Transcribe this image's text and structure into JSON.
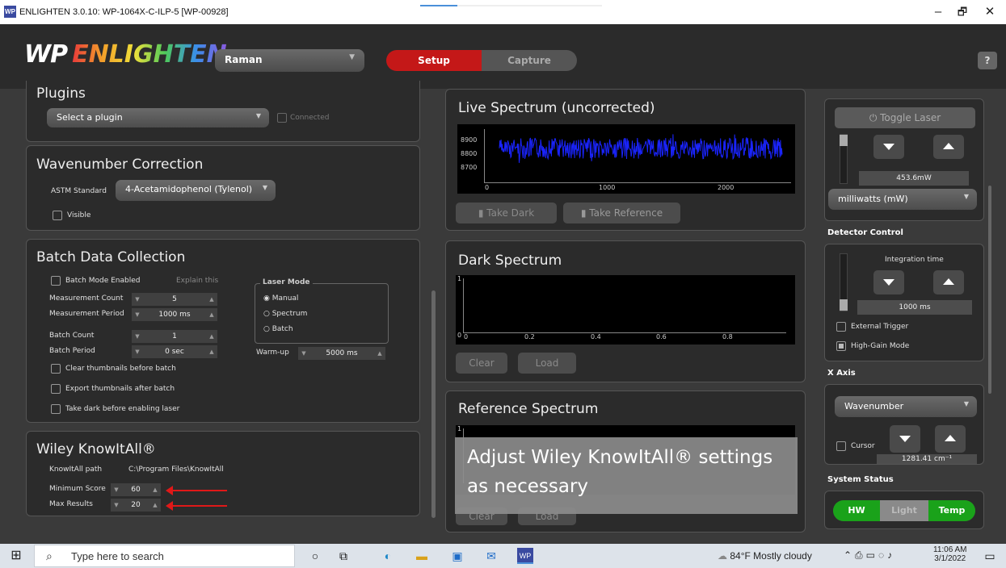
{
  "window": {
    "title": "ENLIGHTEN 3.0.10: WP-1064X-C-ILP-5 [WP-00928]",
    "icon": "wp-app-icon",
    "min": "–",
    "max": "🗗",
    "close": "✕"
  },
  "header": {
    "logo_wp": "WP",
    "logo_name": "ENLIGHTEN",
    "mode": "Raman",
    "tabs": {
      "setup": "Setup",
      "capture": "Capture"
    },
    "help": "?"
  },
  "plugins": {
    "title": "Plugins",
    "select": "Select a plugin",
    "connected": "Connected"
  },
  "wavenumber": {
    "title": "Wavenumber Correction",
    "astm_label": "ASTM Standard",
    "astm_value": "4-Acetamidophenol (Tylenol)",
    "visible": "Visible"
  },
  "batch": {
    "title": "Batch Data Collection",
    "enabled": "Batch Mode Enabled",
    "explain": "Explain this",
    "rows": [
      {
        "label": "Measurement Count",
        "value": "5"
      },
      {
        "label": "Measurement Period",
        "value": "1000 ms"
      },
      {
        "label": "Batch Count",
        "value": "1"
      },
      {
        "label": "Batch Period",
        "value": "0 sec"
      }
    ],
    "laser_mode": {
      "title": "Laser Mode",
      "options": [
        "Manual",
        "Spectrum",
        "Batch"
      ],
      "selected": "Manual"
    },
    "warmup_label": "Warm-up",
    "warmup_value": "5000 ms",
    "checks": [
      "Clear thumbnails before batch",
      "Export thumbnails after batch",
      "Take dark before enabling laser"
    ]
  },
  "knowitall": {
    "title": "Wiley KnowItAll®",
    "path_label": "KnowItAll path",
    "path_value": "C:\\Program Files\\KnowItAll",
    "min_label": "Minimum Score",
    "min_value": "60",
    "max_label": "Max Results",
    "max_value": "20"
  },
  "live": {
    "title": "Live Spectrum (uncorrected)",
    "yticks": [
      "8900",
      "8800",
      "8700"
    ],
    "xticks": [
      "0",
      "1000",
      "2000"
    ],
    "take_dark": "Take Dark",
    "take_reference": "Take Reference"
  },
  "dark": {
    "title": "Dark Spectrum",
    "ytop": "1",
    "ybottom": "0",
    "xticks": [
      "0",
      "0.2",
      "0.4",
      "0.6",
      "0.8"
    ],
    "clear": "Clear",
    "load": "Load"
  },
  "reference": {
    "title": "Reference Spectrum",
    "ytop": "1",
    "clear": "Clear",
    "load": "Load"
  },
  "caption": "Adjust Wiley KnowItAll® settings as necessary",
  "laser": {
    "toggle": "Toggle Laser",
    "power": "453.6mW",
    "unit": "milliwatts (mW)"
  },
  "detector": {
    "title": "Detector Control",
    "integration_label": "Integration time",
    "integration_value": "1000 ms",
    "external_trigger": "External Trigger",
    "high_gain": "High-Gain Mode"
  },
  "xaxis": {
    "title": "X Axis",
    "unit": "Wavenumber",
    "cursor": "Cursor",
    "cursor_value": "1281.41 cm⁻¹"
  },
  "system": {
    "title": "System Status",
    "hw": "HW",
    "light": "Light",
    "temp": "Temp",
    "colors": {
      "hw": "#1aa21a",
      "light": "#8a8a8a",
      "temp": "#1aa21a"
    }
  },
  "taskbar": {
    "search": "Type here to search",
    "weather": "84°F  Mostly cloudy",
    "time": "11:06 AM",
    "date": "3/1/2022"
  },
  "colors": {
    "accent": "#c41818",
    "spectrum": "#1a24ff"
  }
}
